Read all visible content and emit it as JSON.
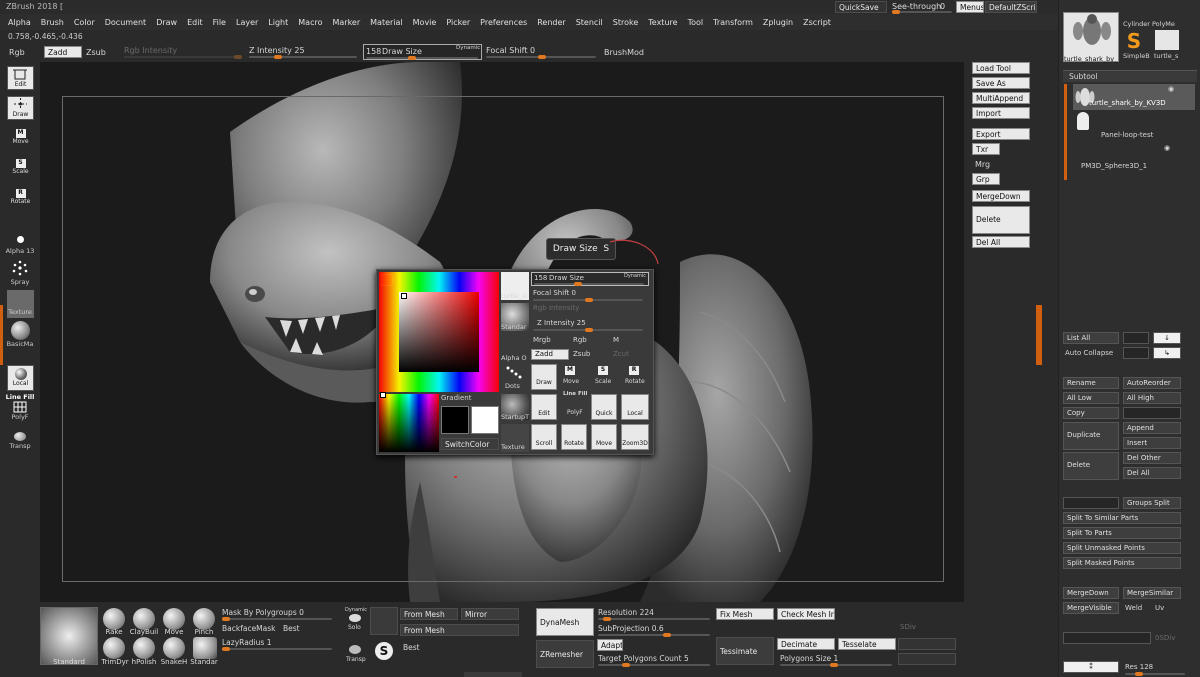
{
  "window": {
    "title": "ZBrush 2018 ["
  },
  "topright": {
    "quicksave": "QuickSave",
    "seethrough": "See-through",
    "seethrough_value": "0",
    "menus": "Menus",
    "script": "DefaultZScript"
  },
  "menu": [
    "Alpha",
    "Brush",
    "Color",
    "Document",
    "Draw",
    "Edit",
    "File",
    "Layer",
    "Light",
    "Macro",
    "Marker",
    "Material",
    "Movie",
    "Picker",
    "Preferences",
    "Render",
    "Stencil",
    "Stroke",
    "Texture",
    "Tool",
    "Transform",
    "Zplugin",
    "Zscript"
  ],
  "coords": "0.758,-0.465,-0.436",
  "toolbar": {
    "rgb": "Rgb",
    "zadd": "Zadd",
    "zsub": "Zsub",
    "rgb_intensity": "Rgb Intensity",
    "z_intensity": "Z Intensity",
    "z_intensity_value": "25",
    "draw_size_value": "158",
    "draw_size": "Draw Size",
    "dynamic": "Dynamic",
    "focal_shift": "Focal Shift",
    "focal_shift_value": "0",
    "brushmod": "BrushMod"
  },
  "left_tools": {
    "edit": "Edit",
    "draw": "Draw",
    "move": "Move",
    "scale": "Scale",
    "rotate": "Rotate",
    "alpha": "Alpha 13",
    "spray": "Spray",
    "texture": "Texture",
    "material": "BasicMa",
    "local": "Local",
    "linefill": "Line Fill",
    "polyf": "PolyF",
    "transp": "Transp"
  },
  "tool_buttons": {
    "load": "Load Tool",
    "saveas": "Save As",
    "multiappend": "MultiAppend",
    "import": "Import",
    "export": "Export",
    "txr": "Txr",
    "mrg": "Mrg",
    "grp": "Grp",
    "mergedown": "MergeDown",
    "delete": "Delete",
    "delall": "Del All"
  },
  "tooltip": {
    "label": "Draw Size",
    "key": "S"
  },
  "popup": {
    "draw_size_value": "158",
    "draw_size": "Draw Size",
    "dynamic": "Dynamic",
    "focal_shift": "Focal Shift",
    "focal_shift_value": "0",
    "rgb_intensity": "Rgb Intensity",
    "z_intensity": "Z Intensity",
    "z_intensity_value": "25",
    "mrgb": "Mrgb",
    "rgb": "Rgb",
    "m": "M",
    "zadd": "Zadd",
    "zsub": "Zsub",
    "zcut": "Zcut",
    "gradient": "Gradient",
    "switchcolor": "SwitchColor",
    "thumb1": "turtle_sl",
    "thumb2": "Standar",
    "thumb3": "Alpha O",
    "thumb4": "Dots",
    "thumb5": "StartupT",
    "thumb6": "Texture",
    "draw": "Draw",
    "move": "Move",
    "scale": "Scale",
    "rotate": "Rotate",
    "edit": "Edit",
    "polyf": "PolyF",
    "quick": "Quick",
    "local": "Local",
    "linefill": "Line Fill",
    "scroll": "Scroll",
    "rotate2": "Rotate",
    "move2": "Move",
    "zoom3d": "Zoom3D"
  },
  "rightpanel": {
    "tool_cylinder": "Cylinder PolyMe",
    "tool_turtle": "turtle_shark_by_l",
    "tool_simpleb": "SimpleB",
    "tool_turtle2": "turtle_s",
    "subtool": "Subtool",
    "subtools": [
      "turtle_shark_by_KV3D",
      "Panel-loop-test",
      "PM3D_Sphere3D_1"
    ],
    "listall": "List All",
    "autocollapse": "Auto Collapse",
    "rename": "Rename",
    "autoreorder": "AutoReorder",
    "alllow": "All Low",
    "allhigh": "All High",
    "copy": "Copy",
    "duplicate": "Duplicate",
    "append": "Append",
    "insert": "Insert",
    "delete": "Delete",
    "delother": "Del Other",
    "delall": "Del All",
    "groupssplit": "Groups Split",
    "splitsimilar": "Split To Similar Parts",
    "splitparts": "Split To Parts",
    "splitunmasked": "Split Unmasked Points",
    "splitmasked": "Split Masked Points",
    "mergedown": "MergeDown",
    "mergesimilar": "MergeSimilar",
    "mergevisible": "MergeVisible",
    "weld": "Weld",
    "uv": "Uv",
    "osdiv": "0SDiv",
    "res": "Res",
    "res_value": "128"
  },
  "shelf": {
    "standard": "Standard",
    "brushes": [
      "Rake",
      "ClayBuil",
      "Move",
      "Pinch",
      "TrimDyr",
      "hPolish",
      "SnakeH",
      "Standar"
    ],
    "maskbypolygroups": "Mask By Polygroups",
    "mask_value": "0",
    "backfacemask": "BackfaceMask",
    "best": "Best",
    "lazyradius": "LazyRadius",
    "lazy_value": "1",
    "dynamic": "Dynamic",
    "solo": "Solo",
    "transp": "Transp",
    "best2": "Best",
    "frommesh": "From Mesh",
    "mirror": "Mirror",
    "frommesh2": "From Mesh",
    "dynamesh": "DynaMesh",
    "resolution": "Resolution",
    "resolution_value": "224",
    "subprojection": "SubProjection",
    "subprojection_value": "0.6",
    "zremesher": "ZRemesher",
    "adapt": "Adapt",
    "targetpolygons": "Target Polygons Count",
    "target_value": "5",
    "fixmesh": "Fix Mesh",
    "checkmesh": "Check Mesh Int",
    "tessimate": "Tessimate",
    "decimate": "Decimate",
    "tesselate": "Tesselate",
    "polygonssize": "Polygons Size",
    "polygons_value": "1",
    "sdiv": "SDiv"
  },
  "colors": {
    "accent": "#e07820",
    "bg": "#2a2a2a",
    "viewport": "#1b1b1b"
  }
}
